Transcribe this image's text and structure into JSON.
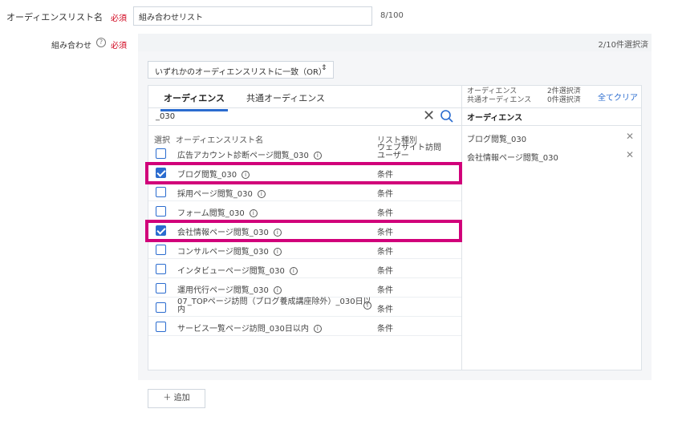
{
  "form": {
    "name_label": "オーディエンスリスト名",
    "required": "必須",
    "name_value": "組み合わせリスト",
    "name_count": "8/100",
    "combo_label": "組み合わせ",
    "help": "?",
    "selected_count": "2/10件選択済",
    "add_button": "＋ 追加"
  },
  "match": {
    "value": "いずれかのオーディエンスリストに一致（OR）",
    "arrow": "⇕"
  },
  "tabs": {
    "audience": "オーディエンス",
    "shared": "共通オーディエンス"
  },
  "search": {
    "value": "_030",
    "clear": "✕"
  },
  "columns": {
    "select": "選択",
    "name": "オーディエンスリスト名",
    "type": "リスト種別"
  },
  "rows": [
    {
      "name": "広告アカウント診断ページ閲覧_030",
      "type": "ウェブサイト訪問\nユーザー",
      "checked": false
    },
    {
      "name": "ブログ閲覧_030",
      "type": "条件",
      "checked": true
    },
    {
      "name": "採用ページ閲覧_030",
      "type": "条件",
      "checked": false
    },
    {
      "name": "フォーム閲覧_030",
      "type": "条件",
      "checked": false
    },
    {
      "name": "会社情報ページ閲覧_030",
      "type": "条件",
      "checked": true
    },
    {
      "name": "コンサルページ閲覧_030",
      "type": "条件",
      "checked": false
    },
    {
      "name": "インタビューページ閲覧_030",
      "type": "条件",
      "checked": false
    },
    {
      "name": "運用代行ページ閲覧_030",
      "type": "条件",
      "checked": false
    },
    {
      "name": "07_TOPページ訪問（ブログ養成講座除外）_030日以\n内",
      "type": "条件",
      "checked": false
    },
    {
      "name": "サービス一覧ページ訪問_030日以内",
      "type": "条件",
      "checked": false
    }
  ],
  "right": {
    "audience_label": "オーディエンス",
    "audience_count": "2件選択済",
    "shared_label": "共通オーディエンス",
    "shared_count": "0件選択済",
    "clear_all": "全てクリア",
    "title": "オーディエンス",
    "selected": [
      "ブログ閲覧_030",
      "会社情報ページ閲覧_030"
    ],
    "remove": "✕"
  },
  "colors": {
    "accent": "#2b6ccf",
    "highlight": "#d1007a",
    "required": "#d0021b"
  }
}
